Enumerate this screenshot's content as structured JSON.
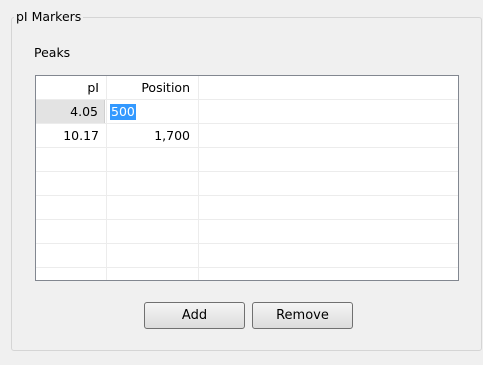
{
  "group": {
    "title": "pI Markers"
  },
  "peaks": {
    "label": "Peaks",
    "columns": [
      "pI",
      "Position"
    ],
    "rows": [
      {
        "pi": "4.05",
        "position": "500",
        "editing": true
      },
      {
        "pi": "10.17",
        "position": "1,700",
        "editing": false
      }
    ]
  },
  "buttons": {
    "add": "Add",
    "remove": "Remove"
  },
  "colors": {
    "selection": "#3399ff",
    "border": "#828790"
  }
}
